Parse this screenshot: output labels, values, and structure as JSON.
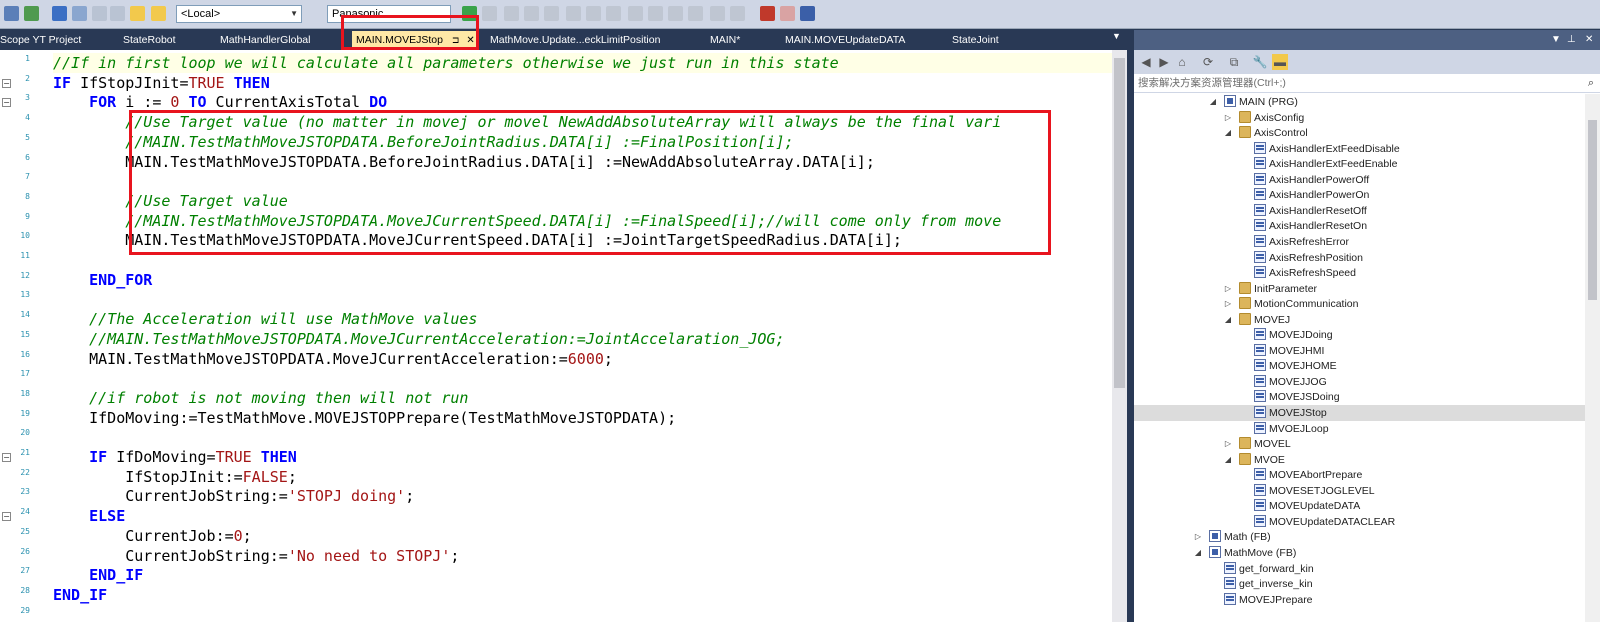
{
  "toolbar": {
    "config_combo": "<Local>",
    "platform_combo": "Panasonic"
  },
  "tabs": [
    {
      "label": "Scope YT Project"
    },
    {
      "label": "StateRobot"
    },
    {
      "label": "MathHandlerGlobal"
    },
    {
      "label": "MAIN.MOVEJStop",
      "active": true
    },
    {
      "label": "MathMove.Update...eckLimitPosition"
    },
    {
      "label": "MAIN*"
    },
    {
      "label": "MAIN.MOVEUpdateDATA"
    },
    {
      "label": "StateJoint"
    }
  ],
  "editor": {
    "line_numbers": [
      "1",
      "2",
      "3",
      "4",
      "5",
      "6",
      "7",
      "8",
      "9",
      "10",
      "11",
      "12",
      "13",
      "14",
      "15",
      "16",
      "17",
      "18",
      "19",
      "20",
      "21",
      "22",
      "23",
      "24",
      "25",
      "26",
      "27",
      "28",
      "29"
    ],
    "lines": [
      "//If in first loop we will calculate all parameters otherwise we just run in this state",
      "IF IfStopJInit=TRUE THEN",
      "    FOR i := 0 TO CurrentAxisTotal DO",
      "        //Use Target value (no matter in movej or movel NewAddAbsoluteArray will always be the final vari",
      "        //MAIN.TestMathMoveJSTOPDATA.BeforeJointRadius.DATA[i] :=FinalPosition[i];",
      "        MAIN.TestMathMoveJSTOPDATA.BeforeJointRadius.DATA[i] :=NewAddAbsoluteArray.DATA[i];",
      "",
      "        //Use Target value",
      "        //MAIN.TestMathMoveJSTOPDATA.MoveJCurrentSpeed.DATA[i] :=FinalSpeed[i];//will come only from move",
      "        MAIN.TestMathMoveJSTOPDATA.MoveJCurrentSpeed.DATA[i] :=JointTargetSpeedRadius.DATA[i];",
      "",
      "    END_FOR",
      "",
      "    //The Acceleration will use MathMove values",
      "    //MAIN.TestMathMoveJSTOPDATA.MoveJCurrentAcceleration:=JointAccelaration_JOG;",
      "    MAIN.TestMathMoveJSTOPDATA.MoveJCurrentAcceleration:=6000;",
      "",
      "    //if robot is not moving then will not run",
      "    IfDoMoving:=TestMathMove.MOVEJSTOPPrepare(TestMathMoveJSTOPDATA);",
      "",
      "    IF IfDoMoving=TRUE THEN",
      "        IfStopJInit:=FALSE;",
      "        CurrentJobString:='STOPJ doing';",
      "    ELSE",
      "        CurrentJob:=0;",
      "        CurrentJobString:='No need to STOPJ';",
      "    END_IF",
      "END_IF",
      ""
    ]
  },
  "panel": {
    "title": "",
    "search_placeholder": "搜索解决方案资源管理器(Ctrl+;)",
    "tree": [
      {
        "label": "MAIN (PRG)",
        "depth": 0,
        "icon": "prg",
        "expander": "open"
      },
      {
        "label": "AxisConfig",
        "depth": 1,
        "icon": "folder",
        "expander": "closed"
      },
      {
        "label": "AxisControl",
        "depth": 1,
        "icon": "folder",
        "expander": "open"
      },
      {
        "label": "AxisHandlerExtFeedDisable",
        "depth": 2,
        "icon": "action",
        "expander": ""
      },
      {
        "label": "AxisHandlerExtFeedEnable",
        "depth": 2,
        "icon": "action",
        "expander": ""
      },
      {
        "label": "AxisHandlerPowerOff",
        "depth": 2,
        "icon": "action",
        "expander": ""
      },
      {
        "label": "AxisHandlerPowerOn",
        "depth": 2,
        "icon": "action",
        "expander": ""
      },
      {
        "label": "AxisHandlerResetOff",
        "depth": 2,
        "icon": "action",
        "expander": ""
      },
      {
        "label": "AxisHandlerResetOn",
        "depth": 2,
        "icon": "action",
        "expander": ""
      },
      {
        "label": "AxisRefreshError",
        "depth": 2,
        "icon": "action",
        "expander": ""
      },
      {
        "label": "AxisRefreshPosition",
        "depth": 2,
        "icon": "action",
        "expander": ""
      },
      {
        "label": "AxisRefreshSpeed",
        "depth": 2,
        "icon": "action",
        "expander": ""
      },
      {
        "label": "InitParameter",
        "depth": 1,
        "icon": "folder",
        "expander": "closed"
      },
      {
        "label": "MotionCommunication",
        "depth": 1,
        "icon": "folder",
        "expander": "closed"
      },
      {
        "label": "MOVEJ",
        "depth": 1,
        "icon": "folder",
        "expander": "open"
      },
      {
        "label": "MOVEJDoing",
        "depth": 2,
        "icon": "action",
        "expander": ""
      },
      {
        "label": "MOVEJHMI",
        "depth": 2,
        "icon": "action",
        "expander": ""
      },
      {
        "label": "MOVEJHOME",
        "depth": 2,
        "icon": "action",
        "expander": ""
      },
      {
        "label": "MOVEJJOG",
        "depth": 2,
        "icon": "action",
        "expander": ""
      },
      {
        "label": "MOVEJSDoing",
        "depth": 2,
        "icon": "action",
        "expander": ""
      },
      {
        "label": "MOVEJStop",
        "depth": 2,
        "icon": "action",
        "expander": "",
        "selected": true
      },
      {
        "label": "MVOEJLoop",
        "depth": 2,
        "icon": "action",
        "expander": ""
      },
      {
        "label": "MOVEL",
        "depth": 1,
        "icon": "folder",
        "expander": "closed"
      },
      {
        "label": "MVOE",
        "depth": 1,
        "icon": "folder",
        "expander": "open"
      },
      {
        "label": "MOVEAbortPrepare",
        "depth": 2,
        "icon": "action",
        "expander": ""
      },
      {
        "label": "MOVESETJOGLEVEL",
        "depth": 2,
        "icon": "action",
        "expander": ""
      },
      {
        "label": "MOVEUpdateDATA",
        "depth": 2,
        "icon": "action",
        "expander": ""
      },
      {
        "label": "MOVEUpdateDATACLEAR",
        "depth": 2,
        "icon": "action",
        "expander": ""
      },
      {
        "label": "Math (FB)",
        "depth": -1,
        "icon": "prg",
        "expander": "closed"
      },
      {
        "label": "MathMove (FB)",
        "depth": -1,
        "icon": "prg",
        "expander": "open"
      },
      {
        "label": "get_forward_kin",
        "depth": 0,
        "icon": "action",
        "expander": ""
      },
      {
        "label": "get_inverse_kin",
        "depth": 0,
        "icon": "action",
        "expander": ""
      },
      {
        "label": "MOVEJPrepare",
        "depth": 0,
        "icon": "action",
        "expander": ""
      }
    ]
  }
}
